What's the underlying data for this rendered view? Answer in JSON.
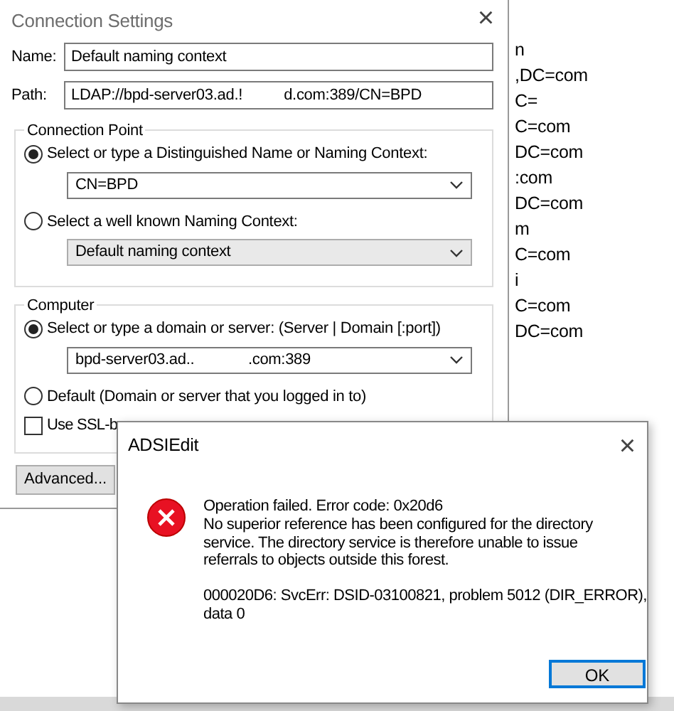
{
  "main_dialog": {
    "title": "Connection Settings",
    "close": "×",
    "fields": [
      {
        "label": "Name:",
        "value": "Default naming context"
      },
      {
        "label": "Path:",
        "value": "LDAP://bpd-server03.ad.!          d.com:389/CN=BPD"
      }
    ],
    "groups": [
      {
        "title": "Connection Point",
        "options": [
          {
            "label": "Select or type a Distinguished Name or Naming Context:",
            "selected": true,
            "combo": {
              "kind": "editable",
              "value": "CN=BPD"
            }
          },
          {
            "label": "Select a well known Naming Context:",
            "selected": false,
            "combo": {
              "kind": "droplist",
              "value": "Default naming context"
            }
          }
        ]
      },
      {
        "title": "Computer",
        "options": [
          {
            "label": "Select or type a domain or server: (Server | Domain [:port])",
            "selected": true,
            "combo": {
              "kind": "editable",
              "value": "bpd-server03.ad..             .com:389"
            }
          },
          {
            "label": "Default (Domain or server that you logged in to)",
            "selected": false
          }
        ],
        "checkbox": {
          "label": "Use SSL-b",
          "checked": false
        }
      }
    ],
    "advanced_button": "Advanced..."
  },
  "background_lines": [
    "n",
    ",DC=com",
    "C=",
    "C=com",
    "DC=com",
    ":com",
    "DC=com",
    "m",
    "C=com",
    "i",
    "C=com",
    "DC=com"
  ],
  "error_dialog": {
    "title": "ADSIEdit",
    "close": "×",
    "paragraphs": [
      [
        "Operation failed. Error code: 0x20d6",
        "No superior reference has been configured for the directory",
        "service. The directory service is therefore unable to issue",
        "referrals to objects outside this forest."
      ],
      [
        "000020D6: SvcErr: DSID-03100821, problem 5012 (DIR_ERROR),",
        "data 0"
      ]
    ],
    "ok_button": "OK"
  }
}
